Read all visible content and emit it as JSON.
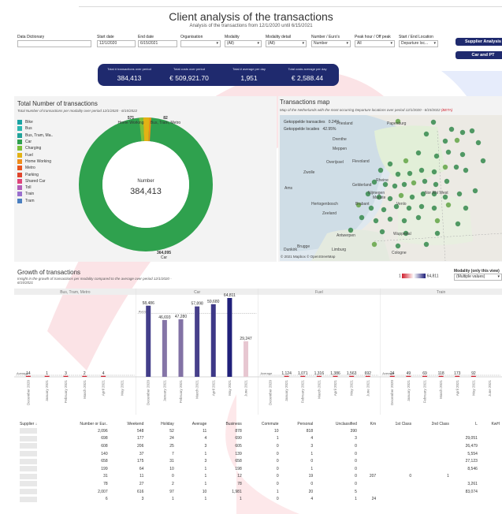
{
  "header": {
    "title": "Client analysis of the transactions",
    "subtitle": "Analysis of the transactions from  12/1/2020 until 6/15/2021"
  },
  "filters": {
    "data_dictionary": {
      "label": "Data Dictionary",
      "value": ""
    },
    "start_date": {
      "label": "Start date",
      "value": "12/1/2020"
    },
    "end_date": {
      "label": "End date",
      "value": "6/15/2021"
    },
    "organisation": {
      "label": "Organisation",
      "value": ""
    },
    "modality": {
      "label": "Modality",
      "value": "(All)"
    },
    "modality_detail": {
      "label": "Modality detail",
      "value": "(All)"
    },
    "number_euro": {
      "label": "Number / Euro's",
      "value": "Number"
    },
    "peak_hour": {
      "label": "Peak hour / Off peak",
      "value": "All"
    },
    "start_end_location": {
      "label": "Start / End Location",
      "value": "Departure loc..."
    }
  },
  "actions": {
    "supplier_analysis": "Supplier Analysis",
    "car_and_pt": "Car and PT"
  },
  "kpis": [
    {
      "label": "Total # transactions over period",
      "value": "384,413"
    },
    {
      "label": "Total costs over period",
      "value": "€ 509,921.70"
    },
    {
      "label": "Total # average per day",
      "value": "1,951"
    },
    {
      "label": "Total costs average per day",
      "value": "€ 2,588.44"
    }
  ],
  "total_panel": {
    "title": "Total Number of transactions",
    "subtitle": "Total Number of transactions per modality over period 12/1/2020 - 6/15/2022",
    "center_label": "Number",
    "center_value": "384,413",
    "top_labels": [
      {
        "value": "571",
        "name": "Home Working"
      },
      {
        "value": "82",
        "name": "Bus, Tram, Metro"
      }
    ],
    "bottom_label": {
      "value": "364,095",
      "name": "Car"
    }
  },
  "legend": [
    {
      "name": "Bike",
      "color": "#1aa3a3"
    },
    {
      "name": "Bus",
      "color": "#2bb7b0"
    },
    {
      "name": "Bus, Tram, Ma..",
      "color": "#21a39a"
    },
    {
      "name": "Car",
      "color": "#2fa14e"
    },
    {
      "name": "Charging",
      "color": "#7bbf3b"
    },
    {
      "name": "Fuel",
      "color": "#e3b214"
    },
    {
      "name": "Home Working",
      "color": "#f08c1a"
    },
    {
      "name": "Metro",
      "color": "#e8531d"
    },
    {
      "name": "Parking",
      "color": "#e0452b"
    },
    {
      "name": "Shared Car",
      "color": "#e0457a"
    },
    {
      "name": "Toll",
      "color": "#b35fb8"
    },
    {
      "name": "Train",
      "color": "#9a6fce"
    },
    {
      "name": "Tram",
      "color": "#4a7fc0"
    }
  ],
  "map_panel": {
    "title": "Transactions map",
    "subtitle": "Map of the Netherlands with the most occurring Departure locations over period 12/1/2020 - 6/15/2022",
    "beta": "(BETA)",
    "info": [
      {
        "label": "Gekoppelde transacties",
        "value": "0.24%"
      },
      {
        "label": "Gekoppelde locaties",
        "value": "42.95%"
      }
    ],
    "places": [
      "Friesland",
      "Drenthe",
      "Meppen",
      "Zwolle",
      "Overijssel",
      "Flevoland",
      "Rheine",
      "Gelderland",
      "Nijmegen",
      "Munste",
      "Hertogenbosch",
      "Zeeland",
      "Brabant",
      "Nor Rhi West",
      "Venlo",
      "Wuppertal",
      "Antwerpen",
      "Brugge",
      "Dunkirk",
      "Limburg",
      "Cologne",
      "Papenburg",
      "Ams"
    ],
    "copyright": "© 2021 Mapbox  © OpenStreetMap"
  },
  "growth_panel": {
    "title": "Growth of transactions",
    "subtitle": "Insight in the growth of transactions per modality compared to the average over period 12/1/2020 - 6/15/2021",
    "color_legend_min": "1",
    "color_legend_max": "64,811",
    "filter_label": "Modality (only this view)",
    "filter_value": "(Multiple values)",
    "average_label": "Average"
  },
  "chart_data": {
    "type": "bar",
    "panels": [
      {
        "name": "Bus, Tram, Metro",
        "categories": [
          "December 2020",
          "January 2021",
          "February 2021",
          "March 2021",
          "April 2021",
          "May 2021"
        ],
        "values": [
          14,
          1,
          3,
          2,
          4,
          null
        ]
      },
      {
        "name": "Car",
        "categories": [
          "December 2020",
          "January 2021",
          "February 2021",
          "March 2021",
          "April 2021",
          "May 2021",
          "June 2021"
        ],
        "values": [
          58486,
          46693,
          47280,
          57898,
          59680,
          64811,
          29247
        ]
      },
      {
        "name": "Fuel",
        "categories": [
          "December 2020",
          "January 2021",
          "February 2021",
          "March 2021",
          "April 2021",
          "May 2021",
          "June 2021"
        ],
        "values": [
          null,
          1124,
          1071,
          1316,
          1386,
          1563,
          692
        ]
      },
      {
        "name": "Train",
        "categories": [
          "December 2020",
          "January 2021",
          "February 2021",
          "March 2021",
          "April 2021",
          "May 2021",
          "June 2021"
        ],
        "values": [
          24,
          49,
          69,
          118,
          173,
          92,
          null
        ]
      }
    ],
    "ylim": [
      0,
      64811
    ]
  },
  "table": {
    "headers": [
      "Supplier ↓",
      "Number or Eur..",
      "Weekend",
      "Holiday",
      "Average",
      "Business",
      "Commute",
      "Personal",
      "Unclassified",
      "Km",
      "1st Class",
      "2nd Class",
      "L",
      "KwH"
    ],
    "rows": [
      [
        "",
        "2,096",
        "548",
        "52",
        "11",
        "878",
        "10",
        "818",
        "390",
        "",
        "",
        "",
        "",
        ""
      ],
      [
        "",
        "698",
        "177",
        "24",
        "4",
        "690",
        "1",
        "4",
        "3",
        "",
        "",
        "",
        "29,051",
        ""
      ],
      [
        "",
        "608",
        "206",
        "25",
        "3",
        "605",
        "0",
        "3",
        "0",
        "",
        "",
        "",
        "26,479",
        ""
      ],
      [
        "",
        "140",
        "37",
        "7",
        "1",
        "139",
        "0",
        "1",
        "0",
        "",
        "",
        "",
        "5,554",
        ""
      ],
      [
        "",
        "658",
        "175",
        "31",
        "3",
        "658",
        "0",
        "0",
        "0",
        "",
        "",
        "",
        "27,123",
        ""
      ],
      [
        "",
        "199",
        "64",
        "10",
        "1",
        "198",
        "0",
        "1",
        "0",
        "",
        "",
        "",
        "8,546",
        ""
      ],
      [
        "",
        "31",
        "11",
        "0",
        "1",
        "12",
        "0",
        "19",
        "0",
        "207",
        "0",
        "1",
        "",
        ""
      ],
      [
        "",
        "78",
        "27",
        "2",
        "1",
        "78",
        "0",
        "0",
        "0",
        "",
        "",
        "",
        "3,261",
        ""
      ],
      [
        "",
        "2,007",
        "616",
        "97",
        "10",
        "1,981",
        "1",
        "20",
        "5",
        "",
        "",
        "",
        "83,074",
        ""
      ],
      [
        "",
        "6",
        "3",
        "1",
        "1",
        "1",
        "0",
        "4",
        "1",
        "24",
        "",
        "",
        "",
        ""
      ]
    ]
  }
}
